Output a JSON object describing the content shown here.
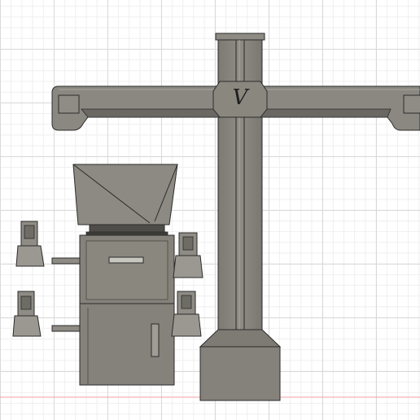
{
  "viewport": {
    "title": "",
    "background_color": "#ffffff",
    "grid_major_color": "#d9d9d9",
    "grid_minor_color": "#efefef",
    "origin_axis_color": "#f2a0a0"
  },
  "model": {
    "name": "wheel-alignment-machine",
    "body_color": "#8a877f",
    "body_light_color": "#a6a39c",
    "body_dark_color": "#5f5c57",
    "edge_color": "#2b2b2b",
    "logo_text": "V"
  }
}
